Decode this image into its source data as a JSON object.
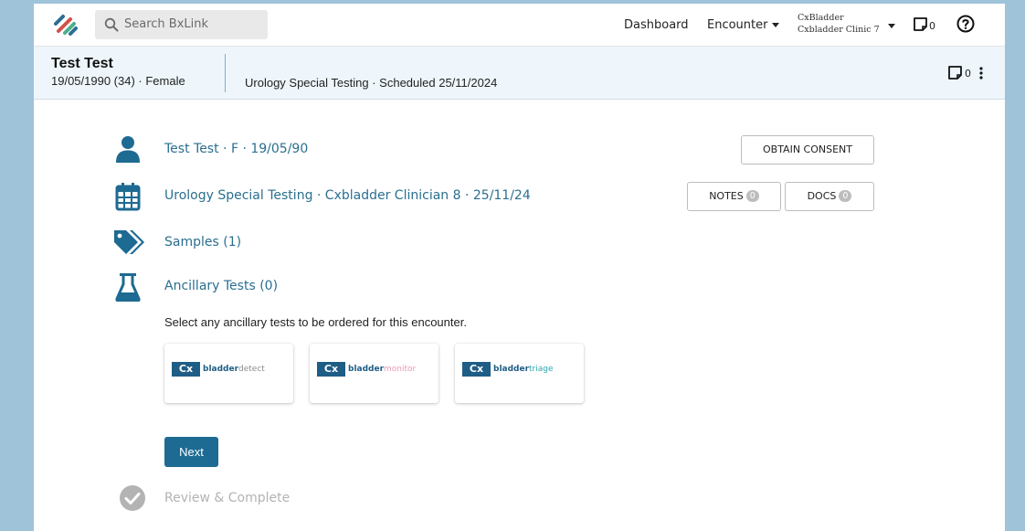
{
  "nav": {
    "search_placeholder": "Search BxLink",
    "dashboard": "Dashboard",
    "encounter": "Encounter",
    "org_name": "CxBladder",
    "clinic_name": "Cxbladder Clinic 7",
    "notes_count": "0"
  },
  "patient": {
    "name": "Test Test",
    "details": "19/05/1990 (34) · Female",
    "encounter": "Urology Special Testing · Scheduled 25/11/2024",
    "notes_count": "0"
  },
  "main": {
    "patient_row": "Test Test · F · 19/05/90",
    "obtain_consent": "OBTAIN CONSENT",
    "encounter_row": "Urology Special Testing · Cxbladder Clinician 8 · 25/11/24",
    "notes_label": "NOTES",
    "notes_count": "0",
    "docs_label": "DOCS",
    "docs_count": "0",
    "samples": "Samples (1)",
    "ancillary": "Ancillary Tests (0)",
    "helptext": "Select any ancillary tests to be ordered for this encounter.",
    "products": [
      {
        "logo": "Cx",
        "prefix": "bladder",
        "suffix": "detect",
        "suffix_color": "#8c8c8c"
      },
      {
        "logo": "Cx",
        "prefix": "bladder",
        "suffix": "monitor",
        "suffix_color": "#e79bb4"
      },
      {
        "logo": "Cx",
        "prefix": "bladder",
        "suffix": "triage",
        "suffix_color": "#2aa7b0"
      }
    ],
    "next": "Next",
    "review": "Review & Complete"
  },
  "colors": {
    "primary": "#1d6a92",
    "link": "#2a6f8f",
    "background": "#9fc3d9",
    "header_bg": "#eef6fb"
  },
  "icons": [
    "logo-icon",
    "search-icon",
    "caret-down-icon",
    "note-icon",
    "help-icon",
    "kebab-icon",
    "person-icon",
    "calendar-icon",
    "tags-icon",
    "flask-icon",
    "check-circle-icon"
  ]
}
